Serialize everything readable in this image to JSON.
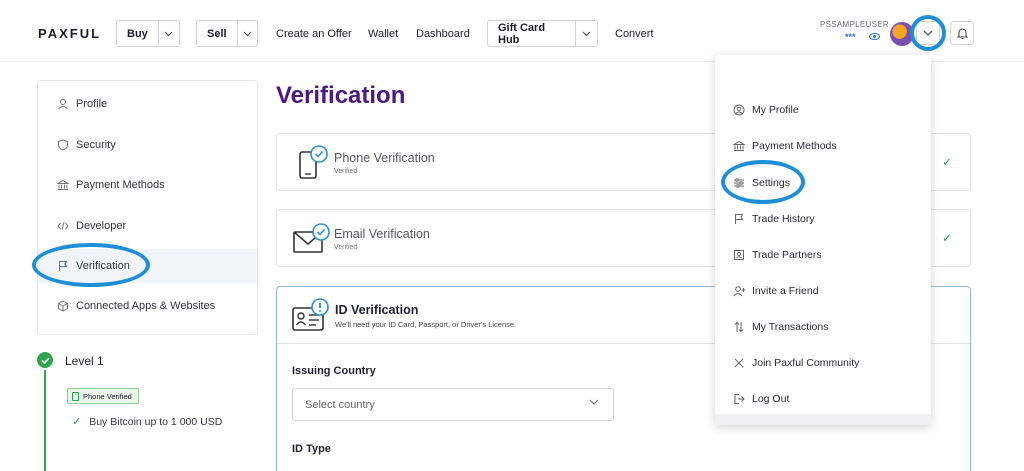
{
  "header": {
    "logo": "PAXFUL",
    "buy_label": "Buy",
    "sell_label": "Sell",
    "create_offer": "Create an Offer",
    "wallet": "Wallet",
    "dashboard": "Dashboard",
    "gift_card_hub": "Gift Card Hub",
    "convert": "Convert",
    "username": "PSSAMPLEUSER",
    "masked_balance": "***"
  },
  "sidebar": {
    "items": [
      {
        "label": "Profile",
        "icon": "user-icon"
      },
      {
        "label": "Security",
        "icon": "shield-icon"
      },
      {
        "label": "Payment Methods",
        "icon": "bank-icon"
      },
      {
        "label": "Developer",
        "icon": "code-icon"
      },
      {
        "label": "Verification",
        "icon": "flag-icon"
      },
      {
        "label": "Connected Apps & Websites",
        "icon": "cube-icon"
      }
    ]
  },
  "level": {
    "title": "Level 1",
    "badge": "Phone Verified",
    "limit": "Buy Bitcoin up to 1 000 USD"
  },
  "main": {
    "title": "Verification",
    "phone": {
      "title": "Phone Verification",
      "status": "Verified"
    },
    "email": {
      "title": "Email Verification",
      "status": "Verified"
    },
    "id": {
      "title": "ID Verification",
      "subtitle": "We'll need your ID Card, Passport, or Driver's License."
    },
    "issuing_country_label": "Issuing Country",
    "country_placeholder": "Select country",
    "id_type_label": "ID Type"
  },
  "dropdown": {
    "items": [
      {
        "label": "My Profile",
        "icon": "user-circle-icon"
      },
      {
        "label": "Payment Methods",
        "icon": "bank-icon"
      },
      {
        "label": "Settings",
        "icon": "sliders-icon"
      },
      {
        "label": "Trade History",
        "icon": "flag-icon"
      },
      {
        "label": "Trade Partners",
        "icon": "contact-card-icon"
      },
      {
        "label": "Invite a Friend",
        "icon": "add-user-icon"
      },
      {
        "label": "My Transactions",
        "icon": "arrows-updown-icon"
      },
      {
        "label": "Join Paxful Community",
        "icon": "community-icon"
      },
      {
        "label": "Log Out",
        "icon": "logout-icon"
      }
    ]
  },
  "colors": {
    "brand_purple": "#4b1985",
    "highlight_blue": "#1d8ed8",
    "verified_green": "#2ea44f"
  }
}
